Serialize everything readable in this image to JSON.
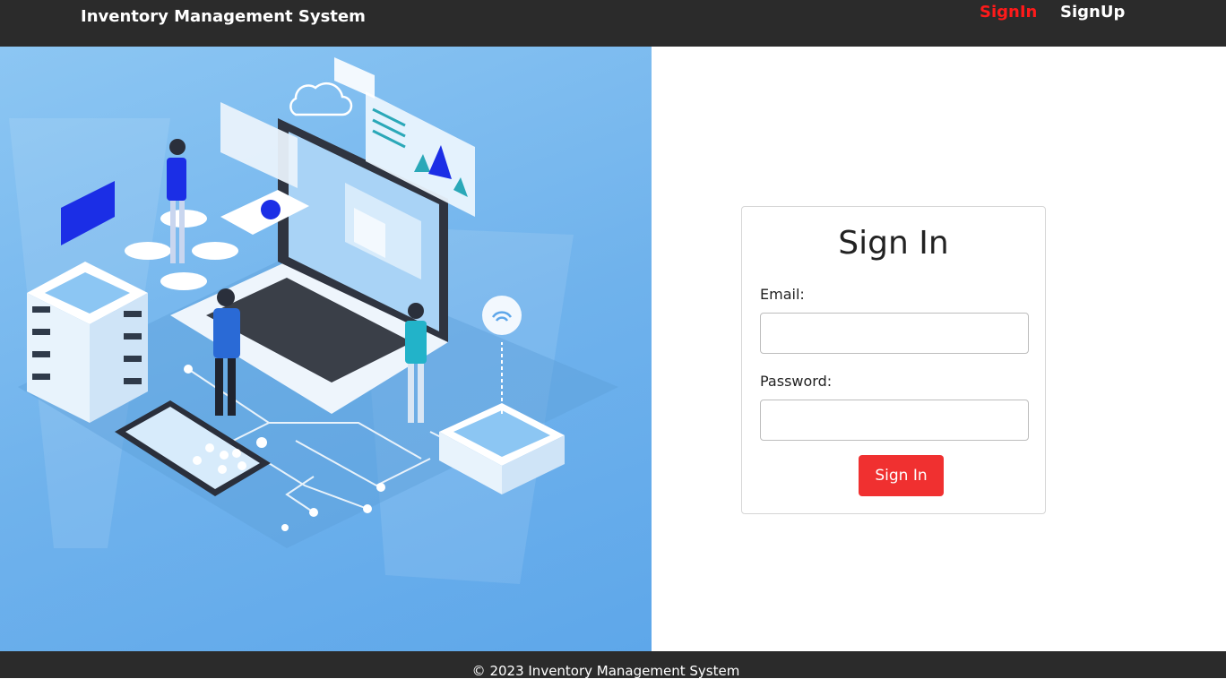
{
  "navbar": {
    "brand": "Inventory Management System",
    "links": [
      {
        "label": "SignIn",
        "active": true
      },
      {
        "label": "SignUp",
        "active": false
      }
    ]
  },
  "login": {
    "title": "Sign In",
    "email_label": "Email:",
    "email_value": "",
    "password_label": "Password:",
    "password_value": "",
    "submit_label": "Sign In"
  },
  "footer": {
    "text": "© 2023 Inventory Management System"
  },
  "colors": {
    "navbar_bg": "#2b2b2b",
    "active_link": "#ff1a1a",
    "button_bg": "#f03030",
    "hero_bg": "#6fb2ec"
  },
  "icons": [
    "wifi-icon",
    "cloud-icon",
    "pie-chart-icon",
    "bar-chart-icon"
  ]
}
